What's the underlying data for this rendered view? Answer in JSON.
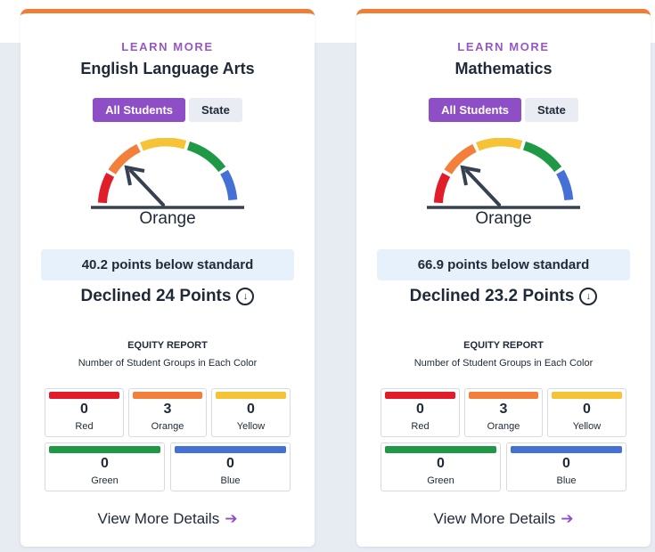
{
  "colors": {
    "red": "#e11d2a",
    "orange": "#f47f3b",
    "yellow": "#f6c236",
    "green": "#1f9945",
    "blue": "#4571d6",
    "accent": "#8e4fc6",
    "card_top": "#ef7d33"
  },
  "cards": [
    {
      "learn_more": "LEARN MORE",
      "subject": "English Language Arts",
      "toggle": {
        "all_students": "All Students",
        "state": "State"
      },
      "gauge_level": "orange",
      "color_label": "Orange",
      "points": "40.2 points below standard",
      "change": "Declined 24 Points",
      "change_icon": "arrow-down-circle-icon",
      "equity": {
        "title": "EQUITY REPORT",
        "subtitle": "Number of Student Groups in Each Color",
        "groups": [
          {
            "count": "0",
            "label": "Red"
          },
          {
            "count": "3",
            "label": "Orange"
          },
          {
            "count": "0",
            "label": "Yellow"
          },
          {
            "count": "0",
            "label": "Green"
          },
          {
            "count": "0",
            "label": "Blue"
          }
        ]
      },
      "details": "View More Details",
      "details_icon": "arrow-right-icon"
    },
    {
      "learn_more": "LEARN MORE",
      "subject": "Mathematics",
      "toggle": {
        "all_students": "All Students",
        "state": "State"
      },
      "gauge_level": "orange",
      "color_label": "Orange",
      "points": "66.9 points below standard",
      "change": "Declined 23.2 Points",
      "change_icon": "arrow-down-circle-icon",
      "equity": {
        "title": "EQUITY REPORT",
        "subtitle": "Number of Student Groups in Each Color",
        "groups": [
          {
            "count": "0",
            "label": "Red"
          },
          {
            "count": "3",
            "label": "Orange"
          },
          {
            "count": "0",
            "label": "Yellow"
          },
          {
            "count": "0",
            "label": "Green"
          },
          {
            "count": "0",
            "label": "Blue"
          }
        ]
      },
      "details": "View More Details",
      "details_icon": "arrow-right-icon"
    }
  ]
}
